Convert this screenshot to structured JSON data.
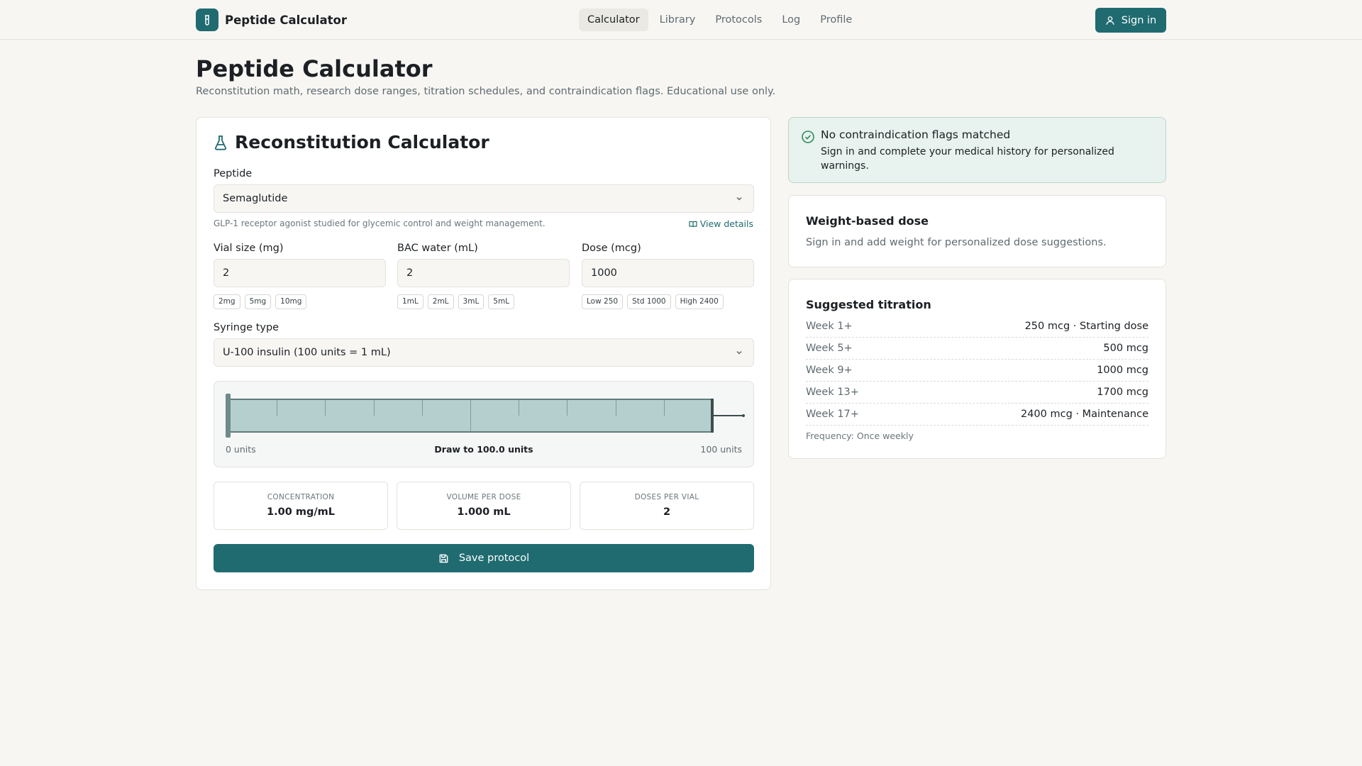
{
  "header": {
    "brand": "Peptide Calculator",
    "nav": [
      "Calculator",
      "Library",
      "Protocols",
      "Log",
      "Profile"
    ],
    "active_nav": "Calculator",
    "signin_label": "Sign in"
  },
  "page": {
    "title": "Peptide Calculator",
    "subtitle": "Reconstitution math, research dose ranges, titration schedules, and contraindication flags. Educational use only."
  },
  "calculator": {
    "title": "Reconstitution Calculator",
    "peptide_label": "Peptide",
    "peptide_value": "Semaglutide",
    "peptide_desc": "GLP-1 receptor agonist studied for glycemic control and weight management.",
    "view_details": "View details",
    "vial_label": "Vial size (mg)",
    "vial_value": "2",
    "vial_chips": [
      "2mg",
      "5mg",
      "10mg"
    ],
    "bac_label": "BAC water (mL)",
    "bac_value": "2",
    "bac_chips": [
      "1mL",
      "2mL",
      "3mL",
      "5mL"
    ],
    "dose_label": "Dose (mcg)",
    "dose_value": "1000",
    "dose_chips": [
      "Low 250",
      "Std 1000",
      "High 2400"
    ],
    "syringe_label": "Syringe type",
    "syringe_value": "U-100 insulin (100 units = 1 mL)",
    "syringe_min": "0 units",
    "syringe_draw": "Draw to 100.0 units",
    "syringe_max": "100 units",
    "syringe_fill_fraction": 1.0,
    "stats": [
      {
        "key": "CONCENTRATION",
        "value": "1.00 mg/mL"
      },
      {
        "key": "VOLUME PER DOSE",
        "value": "1.000 mL"
      },
      {
        "key": "DOSES PER VIAL",
        "value": "2"
      }
    ],
    "save_label": "Save protocol"
  },
  "alert": {
    "title": "No contraindication flags matched",
    "body": "Sign in and complete your medical history for personalized warnings."
  },
  "weight_dose": {
    "title": "Weight-based dose",
    "text": "Sign in and add weight for personalized dose suggestions."
  },
  "titration": {
    "title": "Suggested titration",
    "rows": [
      {
        "week": "Week 1+",
        "dose": "250 mcg · Starting dose"
      },
      {
        "week": "Week 5+",
        "dose": "500 mcg"
      },
      {
        "week": "Week 9+",
        "dose": "1000 mcg"
      },
      {
        "week": "Week 13+",
        "dose": "1700 mcg"
      },
      {
        "week": "Week 17+",
        "dose": "2400 mcg · Maintenance"
      }
    ],
    "frequency": "Frequency: Once weekly"
  },
  "colors": {
    "accent": "#1f6b70",
    "background": "#f7f6f3",
    "success_bg": "#e8f2ee",
    "syringe_fill": "#b4cfcd"
  },
  "icons": [
    "vial-logo-icon",
    "user-icon",
    "flask-icon",
    "chevron-down-icon",
    "book-icon",
    "check-circle-icon",
    "save-icon"
  ]
}
